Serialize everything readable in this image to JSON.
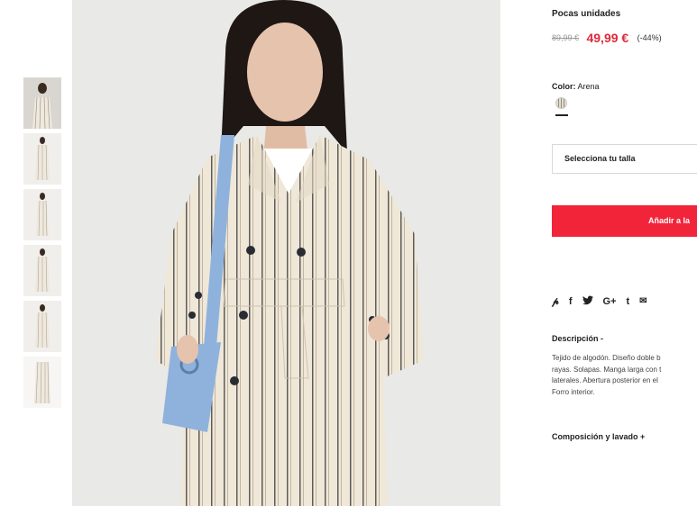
{
  "product": {
    "stock_label": "Pocas unidades",
    "price_old": "89,99 €",
    "price_new": "49,99 €",
    "discount": "(-44%)",
    "color_label": "Color:",
    "color_value": "Arena",
    "size_placeholder": "Selecciona tu talla",
    "add_button_label": "Añadir a la",
    "social_icons": [
      {
        "name": "pinterest-icon",
        "glyph": "𝓅"
      },
      {
        "name": "facebook-icon",
        "glyph": "f"
      },
      {
        "name": "twitter-icon",
        "glyph": "🐦"
      },
      {
        "name": "google-plus-icon",
        "glyph": "G+"
      },
      {
        "name": "tumblr-icon",
        "glyph": "t"
      },
      {
        "name": "email-icon",
        "glyph": "✉"
      }
    ],
    "description_title": "Descripción -",
    "description_lines": [
      "Tejido de algodón. Diseño doble b",
      "rayas. Solapas. Manga larga con t",
      "laterales. Abertura posterior en el",
      "Forro interior."
    ],
    "composition_title": "Composición y lavado +"
  },
  "thumbnails": [
    {
      "label": "view-1"
    },
    {
      "label": "view-2"
    },
    {
      "label": "view-3"
    },
    {
      "label": "view-4"
    },
    {
      "label": "view-5"
    },
    {
      "label": "view-6"
    }
  ],
  "colors": {
    "accent": "#f2243a",
    "sale_price": "#e0293a",
    "text": "#222222"
  }
}
